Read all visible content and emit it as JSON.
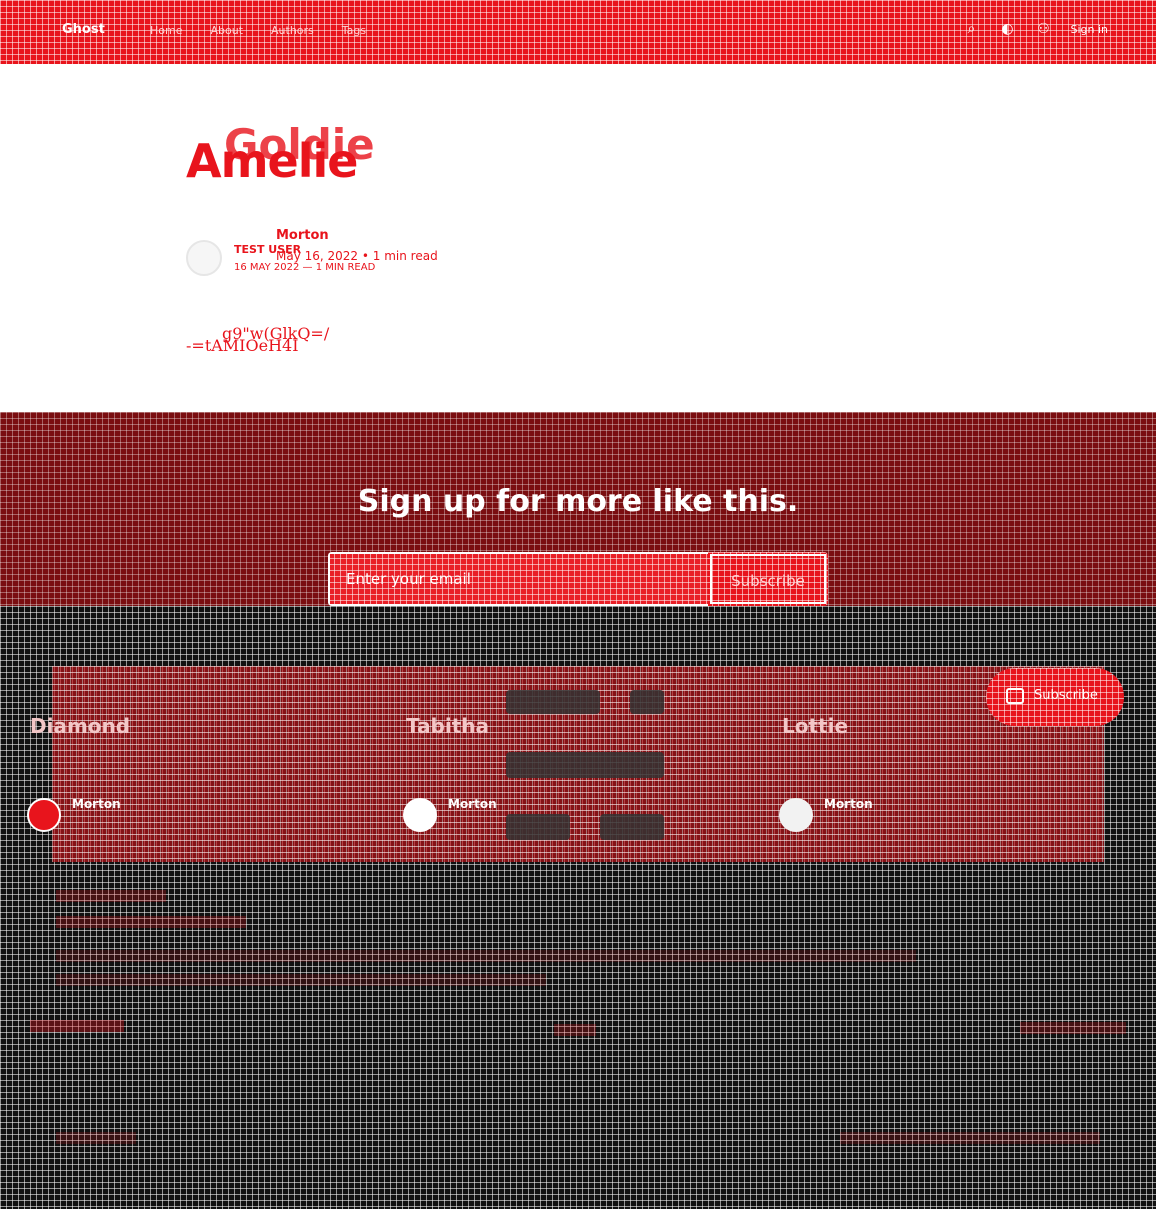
{
  "header": {
    "logo": "Ghost",
    "nav": [
      "Home",
      "About",
      "Authors",
      "Tags"
    ],
    "icons": [
      "search-icon",
      "theme-icon",
      "account-icon"
    ],
    "signin_label": "Sign in"
  },
  "article": {
    "title_primary": "Amelie",
    "title_overlay": "Goldie",
    "author_primary": "Morton",
    "author_secondary": "TEST USER",
    "meta_primary": "May 16, 2022 • 1 min read",
    "meta_secondary": "16 MAY 2022 — 1 MIN READ",
    "body_line_1": "g9\"w(GlkQ=/",
    "body_line_2": "-=tAMIOeH4I"
  },
  "signup": {
    "title": "Sign up for more like this.",
    "email_placeholder": "Enter your email",
    "button": "Subscribe"
  },
  "footer": {
    "subscribe_button": "Subscribe",
    "people": [
      {
        "name": "Diamond",
        "role": "Morton"
      },
      {
        "name": "Tabitha",
        "role": "Morton"
      },
      {
        "name": "Lottie",
        "role": "Morton"
      }
    ]
  },
  "colors": {
    "accent": "#e8141c",
    "accent_dark": "#7a0d10",
    "footer_bg": "#111111"
  }
}
